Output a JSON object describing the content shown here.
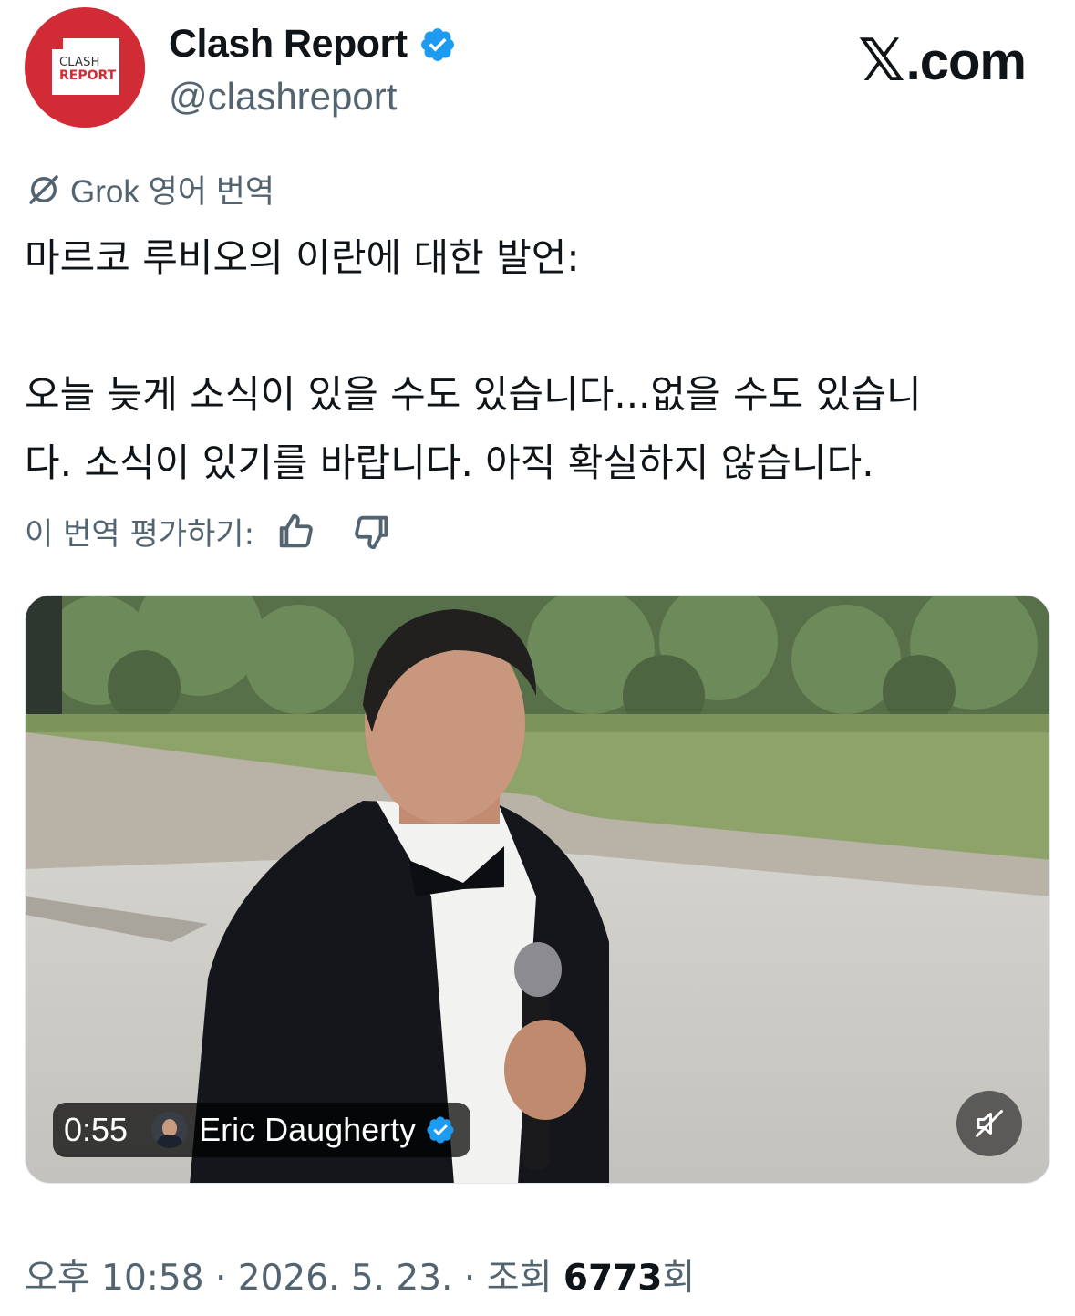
{
  "author": {
    "logo_line1": "CLASH",
    "logo_line2": "REPORT",
    "display_name": "Clash Report",
    "handle": "@clashreport",
    "verified": true,
    "logo_color": "#d12b35"
  },
  "brand": {
    "label": ".com",
    "x_glyph": "𝕏"
  },
  "translation": {
    "label": "Grok 영어 번역",
    "icon": "grok-icon"
  },
  "tweet": {
    "line1": "마르코 루비오의 이란에 대한 발언:",
    "line2": "오늘 늦게 소식이 있을 수도 있습니다...없을 수도 있습니",
    "line3": "다. 소식이 있기를 바랍니다. 아직 확실하지 않습니다."
  },
  "rating": {
    "label": "이 번역 평가하기:",
    "icons": [
      "thumbs-up-icon",
      "thumbs-down-icon"
    ]
  },
  "media": {
    "duration": "0:55",
    "credit": "Eric Daugherty",
    "credit_verified": true,
    "mute_icon": "speaker-muted-icon"
  },
  "footer": {
    "time": "오후 10:58",
    "sep": "·",
    "date": "2026. 5. 23.",
    "views_label": "조회",
    "views": "6773",
    "views_suffix": "회"
  },
  "colors": {
    "verified": "#1d9bf0",
    "text": "#0f1419",
    "muted": "#536471"
  }
}
